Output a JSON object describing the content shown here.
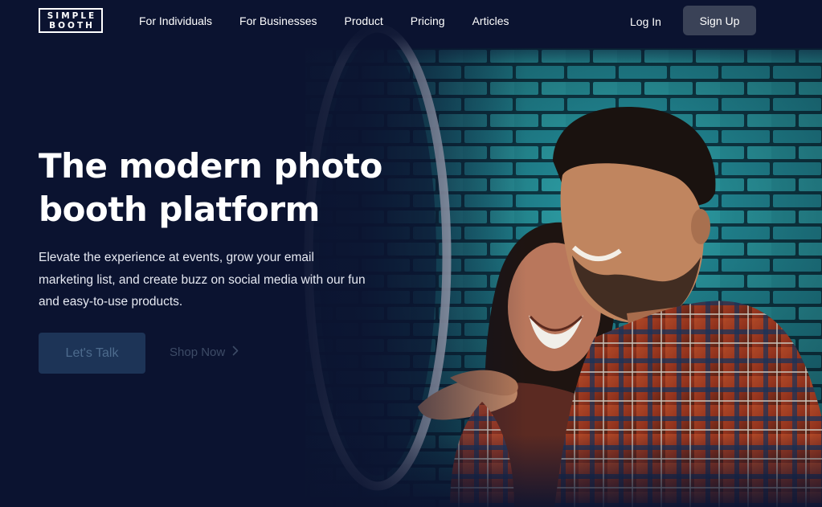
{
  "brand": {
    "logo_line1": "SIMPLE",
    "logo_line2": "BOOTH"
  },
  "nav": {
    "items": [
      "For Individuals",
      "For Businesses",
      "Product",
      "Pricing",
      "Articles"
    ],
    "login_label": "Log In",
    "signup_label": "Sign Up"
  },
  "hero": {
    "title": "The modern photo booth platform",
    "subtitle": "Elevate the experience at events, grow your email marketing list, and create buzz on social media with our fun and easy-to-use products.",
    "primary_cta_label": "Let's Talk",
    "secondary_cta_label": "Shop Now",
    "secondary_cta_icon": "chevron-right-icon"
  },
  "colors": {
    "background": "#0b1330",
    "signup_button": "#3a4257",
    "primary_cta": "#1d3457",
    "brick": "#2a9fa8"
  }
}
